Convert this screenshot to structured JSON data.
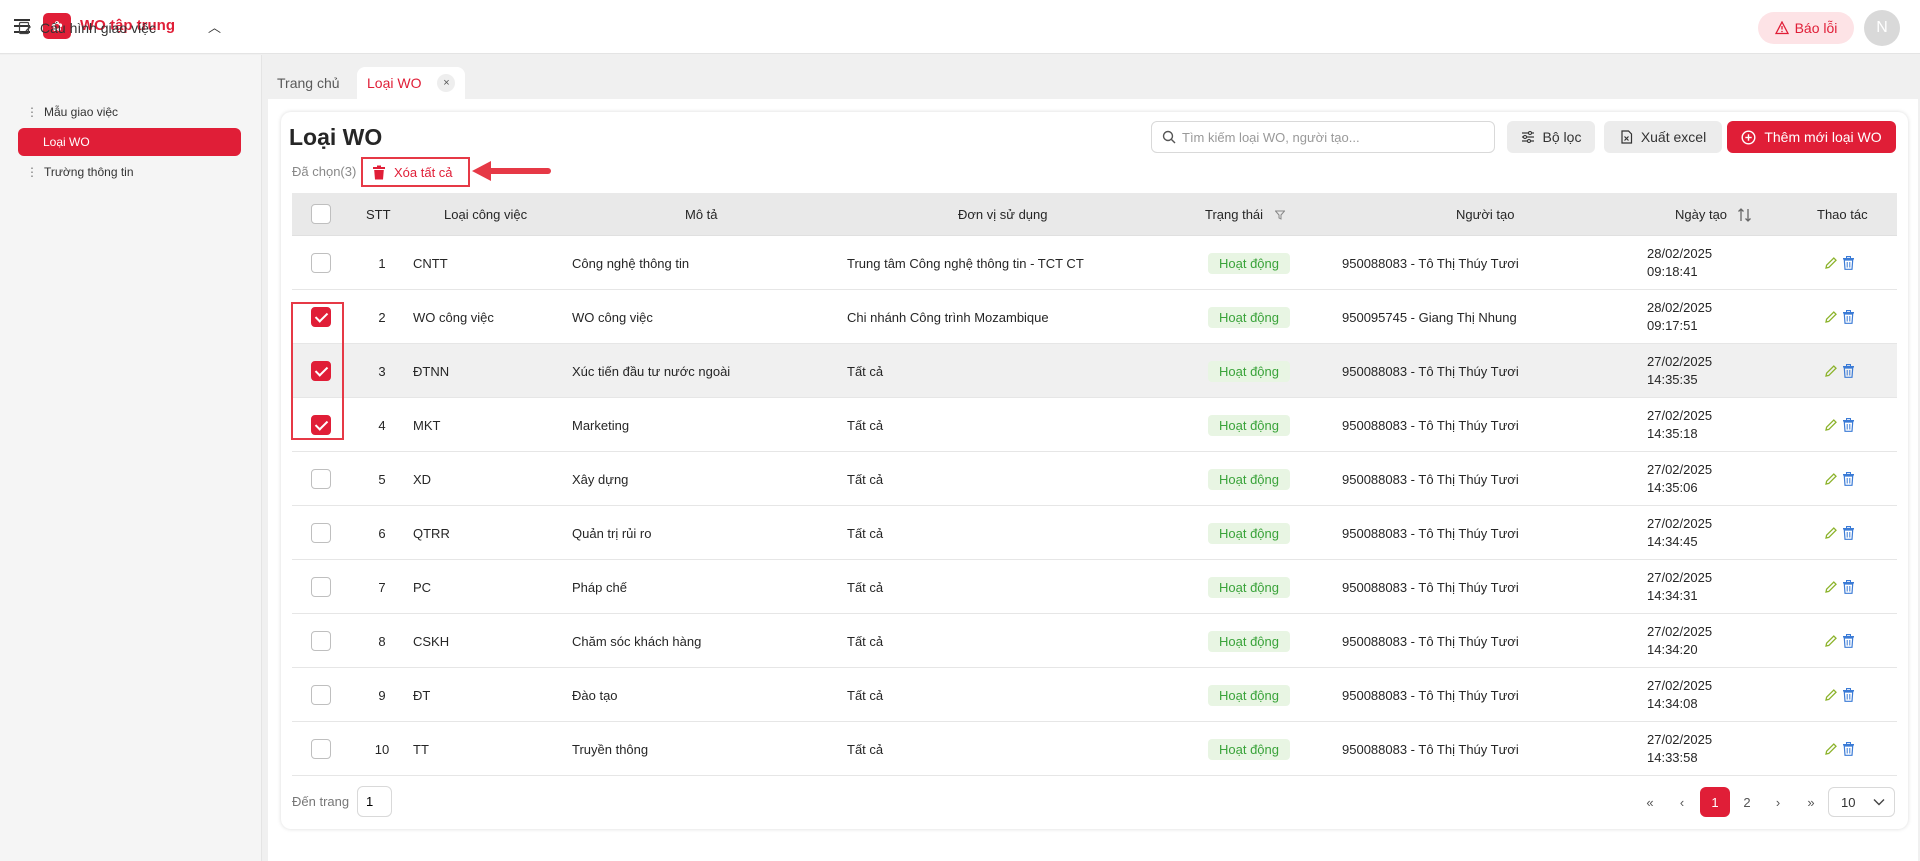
{
  "header": {
    "app_title": "WO tập trung",
    "logo_icon": "logo-icon",
    "report_label": "Báo lỗi",
    "avatar_initial": "N"
  },
  "sidebar": {
    "group_label": "Cấu hình giao việc",
    "items": [
      {
        "label": "Mẫu giao việc",
        "active": false
      },
      {
        "label": "Loại WO",
        "active": true
      },
      {
        "label": "Trường thông tin",
        "active": false
      }
    ]
  },
  "tabs": [
    {
      "label": "Trang chủ",
      "active": false
    },
    {
      "label": "Loại WO",
      "active": true,
      "close": "×"
    }
  ],
  "page": {
    "title": "Loại WO",
    "search_placeholder": "Tìm kiếm loại WO, người tạo...",
    "filter_label": "Bộ lọc",
    "export_label": "Xuất excel",
    "add_label": "Thêm mới loại WO",
    "selected_label": "Đã chọn(3)",
    "delete_all_label": "Xóa tất cả"
  },
  "table": {
    "columns": [
      "STT",
      "Loại công việc",
      "Mô tả",
      "Đơn vị sử dụng",
      "Trạng thái",
      "Người tạo",
      "Ngày tạo",
      "Thao tác"
    ],
    "rows": [
      {
        "checked": false,
        "stt": "1",
        "type": "CNTT",
        "desc": "Công nghệ thông tin",
        "unit": "Trung tâm Công nghệ thông tin - TCT CT",
        "status": "Hoạt động",
        "creator": "950088083 - Tô Thị Thúy Tươi",
        "date": "28/02/2025",
        "time": "09:18:41"
      },
      {
        "checked": true,
        "stt": "2",
        "type": "WO công việc",
        "desc": "WO công việc",
        "unit": "Chi nhánh Công trình Mozambique",
        "status": "Hoạt động",
        "creator": "950095745 - Giang Thị Nhung",
        "date": "28/02/2025",
        "time": "09:17:51"
      },
      {
        "checked": true,
        "stt": "3",
        "type": "ĐTNN",
        "desc": "Xúc tiến đầu tư nước ngoài",
        "unit": "Tất cả",
        "status": "Hoạt động",
        "creator": "950088083 - Tô Thị Thúy Tươi",
        "date": "27/02/2025",
        "time": "14:35:35"
      },
      {
        "checked": true,
        "stt": "4",
        "type": "MKT",
        "desc": "Marketing",
        "unit": "Tất cả",
        "status": "Hoạt động",
        "creator": "950088083 - Tô Thị Thúy Tươi",
        "date": "27/02/2025",
        "time": "14:35:18"
      },
      {
        "checked": false,
        "stt": "5",
        "type": "XD",
        "desc": "Xây dựng",
        "unit": "Tất cả",
        "status": "Hoạt động",
        "creator": "950088083 - Tô Thị Thúy Tươi",
        "date": "27/02/2025",
        "time": "14:35:06"
      },
      {
        "checked": false,
        "stt": "6",
        "type": "QTRR",
        "desc": "Quản trị rủi ro",
        "unit": "Tất cả",
        "status": "Hoạt động",
        "creator": "950088083 - Tô Thị Thúy Tươi",
        "date": "27/02/2025",
        "time": "14:34:45"
      },
      {
        "checked": false,
        "stt": "7",
        "type": "PC",
        "desc": "Pháp chế",
        "unit": "Tất cả",
        "status": "Hoạt động",
        "creator": "950088083 - Tô Thị Thúy Tươi",
        "date": "27/02/2025",
        "time": "14:34:31"
      },
      {
        "checked": false,
        "stt": "8",
        "type": "CSKH",
        "desc": "Chăm sóc khách hàng",
        "unit": "Tất cả",
        "status": "Hoạt động",
        "creator": "950088083 - Tô Thị Thúy Tươi",
        "date": "27/02/2025",
        "time": "14:34:20"
      },
      {
        "checked": false,
        "stt": "9",
        "type": "ĐT",
        "desc": "Đào tạo",
        "unit": "Tất cả",
        "status": "Hoạt động",
        "creator": "950088083 - Tô Thị Thúy Tươi",
        "date": "27/02/2025",
        "time": "14:34:08"
      },
      {
        "checked": false,
        "stt": "10",
        "type": "TT",
        "desc": "Truyền thông",
        "unit": "Tất cả",
        "status": "Hoạt động",
        "creator": "950088083 - Tô Thị Thúy Tươi",
        "date": "27/02/2025",
        "time": "14:33:58"
      }
    ]
  },
  "pagination": {
    "goto_label": "Đến trang",
    "goto_value": "1",
    "pages": [
      "1",
      "2"
    ],
    "current_page": "1",
    "page_size": "10"
  },
  "colors": {
    "accent": "#e01e37",
    "status_bg": "#e8f5e3",
    "status_text": "#3aa33a",
    "annotation": "#e63946"
  }
}
